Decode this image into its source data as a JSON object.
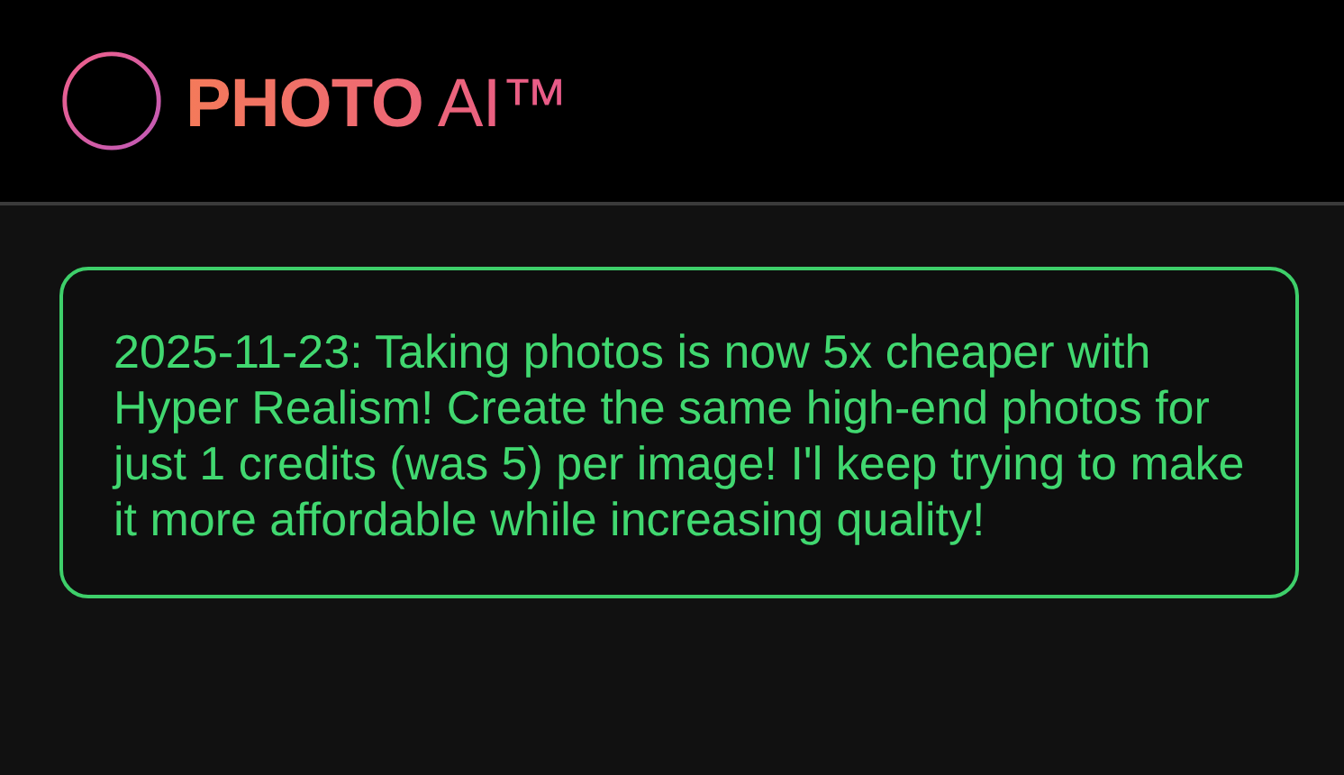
{
  "header": {
    "logo_text": "**PHOTO** AI™"
  },
  "notice": {
    "text": "2025-11-23: Taking photos is now 5x cheaper with Hyper Realism! Create the same high-end photos for just 1 credits (was 5) per image! I'l keep trying to make it more affordable while increasing quality!"
  }
}
